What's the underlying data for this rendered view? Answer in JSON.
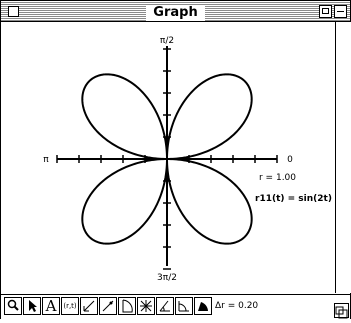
{
  "window": {
    "title": "Graph"
  },
  "graph": {
    "axis_labels": {
      "top": "π/2",
      "left": "π",
      "right": "0",
      "bottom": "3π/2"
    },
    "r_label": "r = 1.00",
    "equation": "r11(t) = sin(2t)",
    "curve": {
      "function": "sin(2t)",
      "petals": 4,
      "color": "#000000"
    }
  },
  "toolbar": {
    "tools": [
      {
        "icon": "magnifier-icon"
      },
      {
        "icon": "arrow-pointer-icon"
      },
      {
        "icon": "text-tool-icon",
        "label": "A"
      },
      {
        "icon": "coordinate-readout-icon",
        "label": "(r,t)"
      },
      {
        "icon": "line-tool-icon"
      },
      {
        "icon": "tangent-tool-icon"
      },
      {
        "icon": "polar-area-tool-icon"
      },
      {
        "icon": "asterisk-tool-icon"
      },
      {
        "icon": "angle-tool-icon"
      },
      {
        "icon": "arc-tool-icon"
      },
      {
        "icon": "sector-fill-tool-icon"
      }
    ],
    "delta_r": "Δr = 0.20"
  }
}
